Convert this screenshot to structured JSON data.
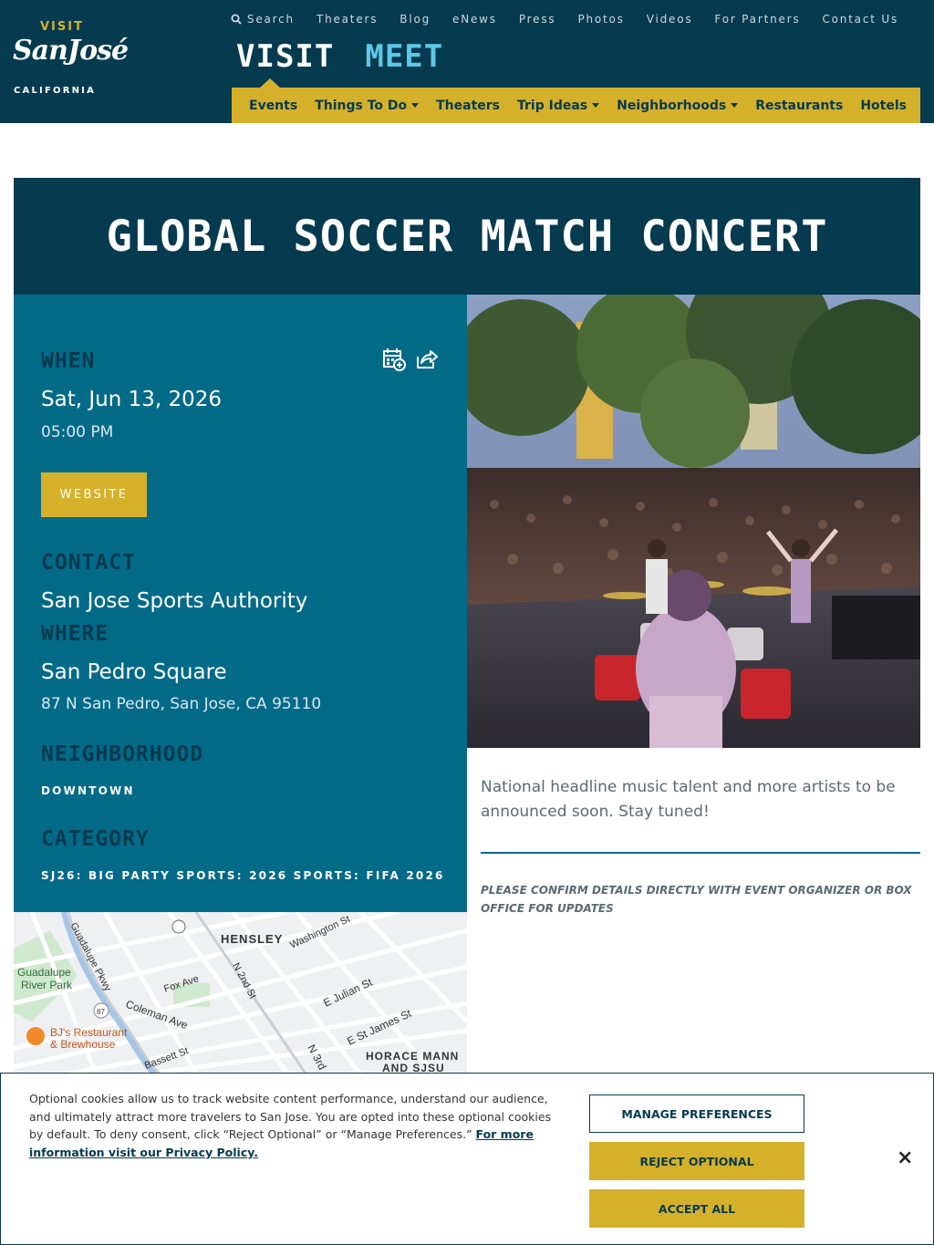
{
  "logo": {
    "visit": "VISIT",
    "name": "SanJosé",
    "region": "CALIFORNIA"
  },
  "top_nav": [
    "Search",
    "Theaters",
    "Blog",
    "eNews",
    "Press",
    "Photos",
    "Videos",
    "For Partners",
    "Contact Us"
  ],
  "big_nav": {
    "visit": "VISIT",
    "meet": "MEET"
  },
  "sub_nav": [
    {
      "label": "Events",
      "dropdown": false
    },
    {
      "label": "Things To Do",
      "dropdown": true
    },
    {
      "label": "Theaters",
      "dropdown": false
    },
    {
      "label": "Trip Ideas",
      "dropdown": true
    },
    {
      "label": "Neighborhoods",
      "dropdown": true
    },
    {
      "label": "Restaurants",
      "dropdown": false
    },
    {
      "label": "Hotels",
      "dropdown": false
    }
  ],
  "event": {
    "title": "GLOBAL SOCCER MATCH CONCERT",
    "when_label": "WHEN",
    "date": "Sat, Jun 13, 2026",
    "time": "05:00 PM",
    "website_label": "WEBSITE",
    "contact_label": "CONTACT",
    "contact": "San Jose Sports Authority",
    "where_label": "WHERE",
    "venue": "San Pedro Square",
    "address": "87 N San Pedro, San Jose, CA 95110",
    "neighborhood_label": "NEIGHBORHOOD",
    "neighborhood": "DOWNTOWN",
    "category_label": "CATEGORY",
    "categories": "SJ26: BIG PARTY SPORTS: 2026 SPORTS: FIFA 2026",
    "description": "National headline music talent and more artists to be announced soon. Stay tuned!",
    "note": "PLEASE CONFIRM DETAILS DIRECTLY WITH EVENT ORGANIZER OR BOX OFFICE FOR UPDATES"
  },
  "map": {
    "labels": [
      "HENSLEY",
      "Washington St",
      "Guadalupe River Park",
      "Guadalupe Pkwy",
      "Fox Ave",
      "N 2nd St",
      "E Julian St",
      "Coleman Ave",
      "BJ's Restaurant & Brewhouse",
      "E St James St",
      "Bassett St",
      "N 3rd",
      "HORACE MANN AND SJSU",
      "87"
    ]
  },
  "cookie": {
    "text": "Optional cookies allow us to track website content performance, understand our audience, and ultimately attract more travelers to San Jose. You are opted into these optional cookies by default. To deny consent, click “Reject Optional” or “Manage Preferences.”",
    "link": "For more information visit our Privacy Policy.",
    "manage": "MANAGE PREFERENCES",
    "reject": "REJECT OPTIONAL",
    "accept": "ACCEPT ALL",
    "close": "×"
  },
  "colors": {
    "navy": "#053a4f",
    "teal": "#036a88",
    "gold": "#d5b12b",
    "sky": "#5ec7e6"
  },
  "icons": [
    "search-icon",
    "add-to-calendar-icon",
    "share-icon",
    "close-icon",
    "restaurant-pin-icon"
  ]
}
